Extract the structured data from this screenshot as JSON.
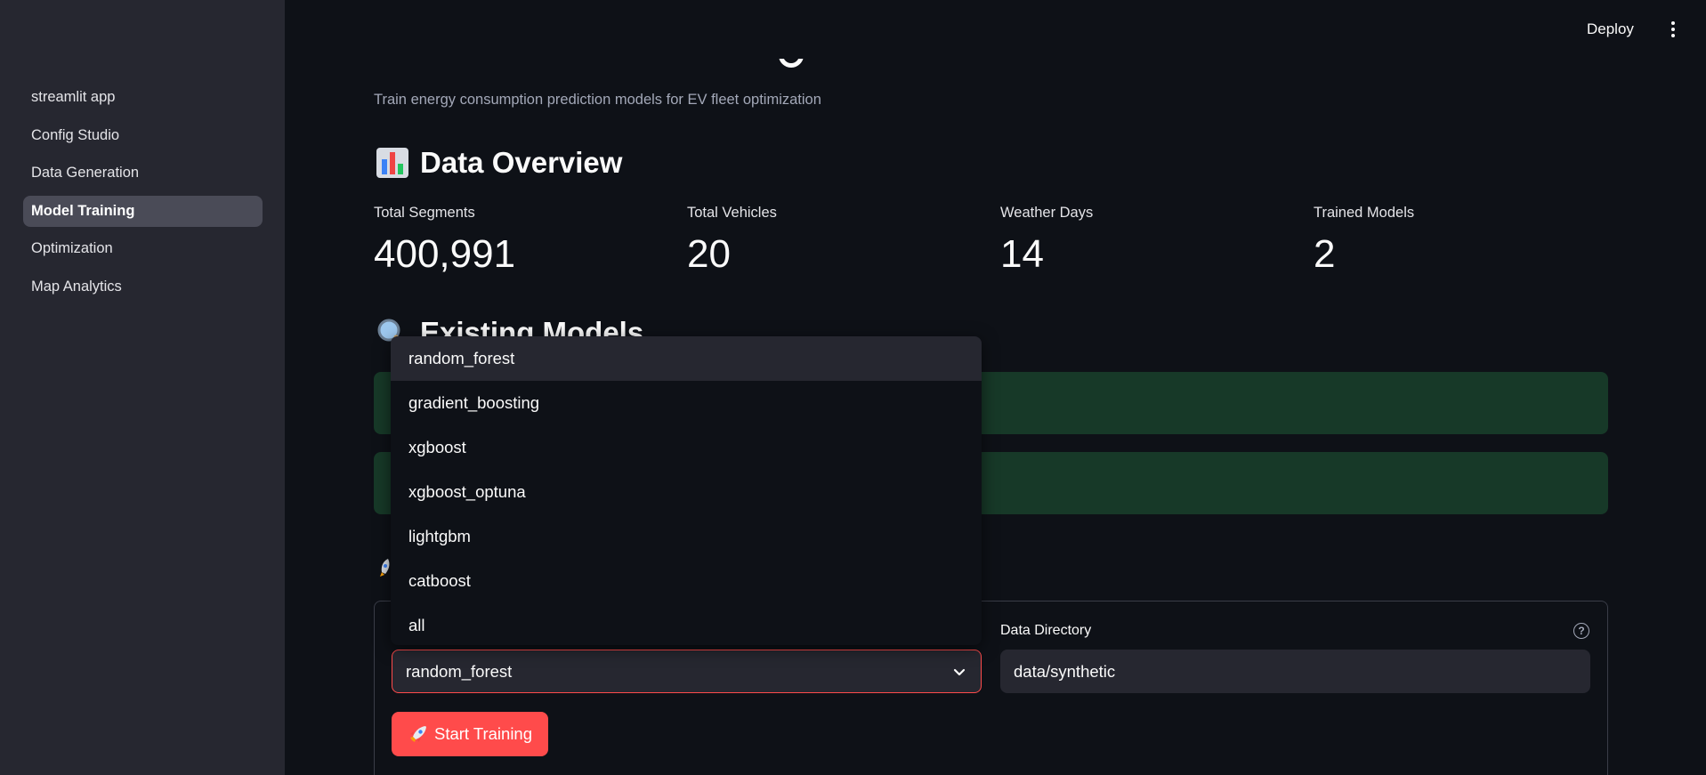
{
  "sidebar": {
    "items": [
      {
        "label": "streamlit app"
      },
      {
        "label": "Config Studio"
      },
      {
        "label": "Data Generation"
      },
      {
        "label": "Model Training",
        "active": true
      },
      {
        "label": "Optimization"
      },
      {
        "label": "Map Analytics"
      }
    ]
  },
  "header": {
    "deploy_label": "Deploy",
    "menu_icon": "kebab-icon"
  },
  "main": {
    "subtitle": "Train energy consumption prediction models for EV fleet optimization",
    "data_overview": {
      "heading": "Data Overview",
      "icon": "bar-chart-icon",
      "metrics": [
        {
          "label": "Total Segments",
          "value": "400,991"
        },
        {
          "label": "Total Vehicles",
          "value": "20"
        },
        {
          "label": "Weather Days",
          "value": "14"
        },
        {
          "label": "Trained Models",
          "value": "2"
        }
      ]
    },
    "existing_models": {
      "heading": "Existing Models",
      "icon": "magnifier-icon"
    },
    "training_form": {
      "icon": "rocket-icon",
      "data_directory_label": "Data Directory",
      "data_directory_value": "data/synthetic",
      "model_select_value": "random_forest",
      "start_button_label": "Start Training"
    },
    "dropdown": {
      "options": [
        "random_forest",
        "gradient_boosting",
        "xgboost",
        "xgboost_optuna",
        "lightgbm",
        "catboost",
        "all"
      ],
      "highlighted": "random_forest"
    }
  },
  "colors": {
    "accent": "#ff4b4b",
    "background": "#0e1117",
    "sidebar": "#262730",
    "success": "#173928"
  }
}
